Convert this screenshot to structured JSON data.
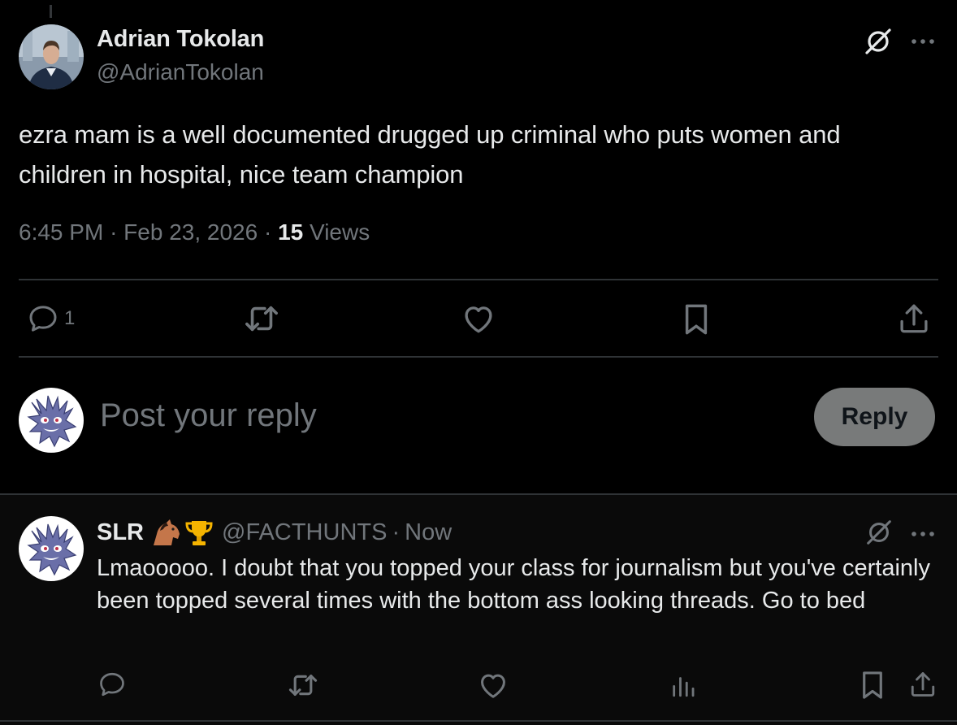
{
  "tweet": {
    "author": {
      "name": "Adrian Tokolan",
      "handle": "@AdrianTokolan"
    },
    "text": "ezra mam is a well documented drugged up criminal who puts women and children in hospital, nice team champion",
    "meta": {
      "time": "6:45 PM",
      "separator": "·",
      "date": "Feb 23, 2026",
      "views_count": "15",
      "views_label": "Views"
    },
    "actions": {
      "reply_count": "1",
      "reply_icon": "comment-icon",
      "retweet_icon": "retweet-icon",
      "like_icon": "heart-icon",
      "bookmark_icon": "bookmark-icon",
      "share_icon": "share-icon"
    }
  },
  "composer": {
    "placeholder": "Post your reply",
    "button_label": "Reply"
  },
  "reply": {
    "name": "SLR",
    "emojis": [
      "horse-emoji",
      "trophy-emoji"
    ],
    "handle": "@FACTHUNTS",
    "separator": "·",
    "time": "Now",
    "text": "Lmaooooo. I doubt that you topped your class for journalism but you've certainly been topped several times with the bottom ass looking threads. Go to bed"
  },
  "colors": {
    "background": "#000000",
    "text_primary": "#e7e9ea",
    "text_secondary": "#71767b",
    "divider": "#2f3336",
    "reply_button_bg": "#787a7a"
  }
}
